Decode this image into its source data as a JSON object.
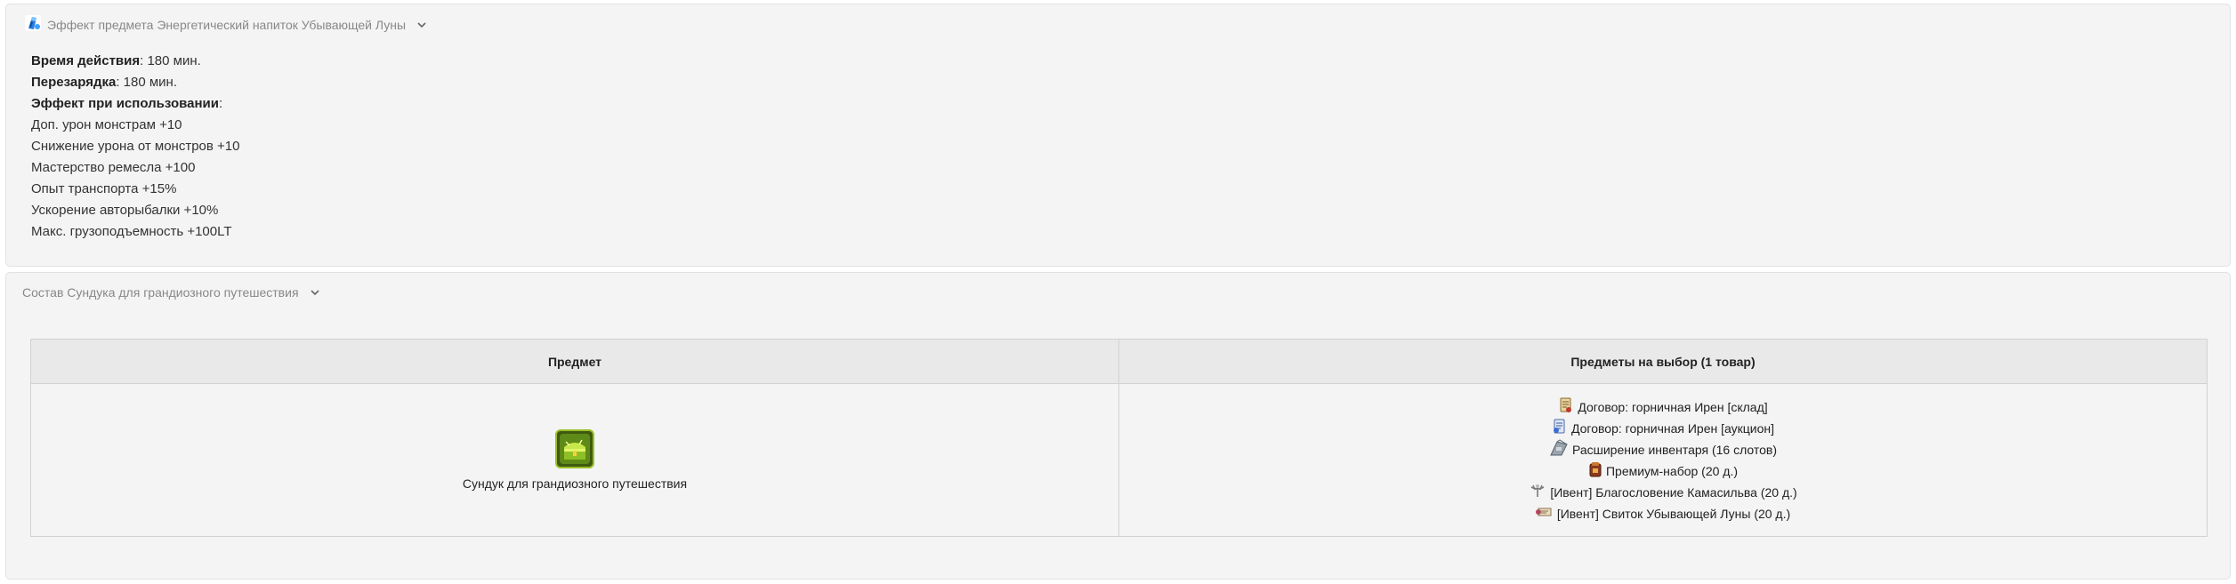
{
  "effect_panel": {
    "icon": "blue-potion-icon",
    "title": "Эффект предмета Энергетический напиток Убывающей Луны",
    "duration_label": "Время действия",
    "duration_value": ": 180 мин.",
    "cooldown_label": "Перезарядка",
    "cooldown_value": ": 180 мин.",
    "use_effect_label": "Эффект при использовании",
    "use_effect_suffix": ":",
    "effects": [
      "Доп. урон монстрам +10",
      "Снижение урона от монстров +10",
      "Мастерство ремесла +100",
      "Опыт транспорта +15%",
      "Ускорение авторыбалки +10%",
      "Макс. грузоподъемность +100LT"
    ]
  },
  "chest_panel": {
    "title": "Состав Сундука для грандиозного путешествия",
    "table": {
      "headers": [
        "Предмет",
        "Предметы на выбор (1 товар)"
      ],
      "item": {
        "icon": "green-chest-icon",
        "name": "Сундук для грандиозного путешествия"
      },
      "choices": [
        {
          "icon": "contract-scroll-icon",
          "label": "Договор: горничная Ирен [склад]"
        },
        {
          "icon": "contract-auction-icon",
          "label": "Договор: горничная Ирен [аукцион]"
        },
        {
          "icon": "inventory-expansion-icon",
          "label": "Расширение инвентаря (16 слотов)"
        },
        {
          "icon": "premium-set-icon",
          "label": "Премиум-набор (20 д.)"
        },
        {
          "icon": "blessing-icon",
          "label": "[Ивент] Благословение Камасильва (20 д.)"
        },
        {
          "icon": "scroll-icon",
          "label": "[Ивент] Свиток Убывающей Луны (20 д.)"
        }
      ]
    }
  },
  "colors": {
    "panel_bg": "#f4f4f4",
    "header_bg": "#e9e9e9",
    "border": "#d2d2d2",
    "title_text": "#888888"
  }
}
